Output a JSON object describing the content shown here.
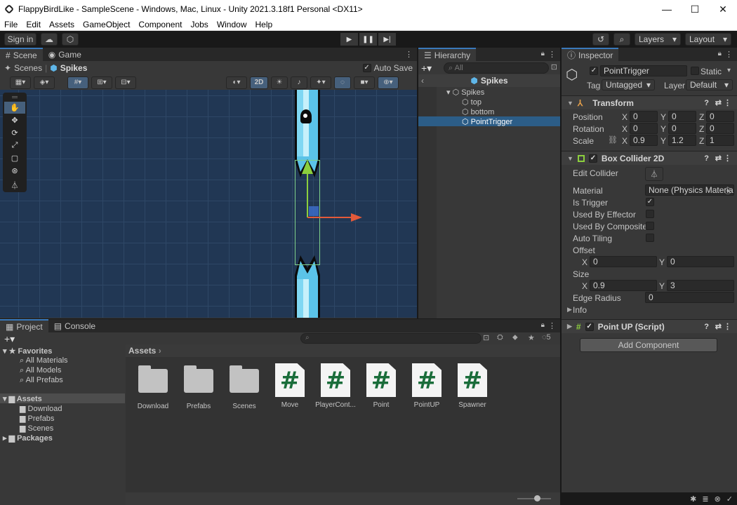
{
  "window": {
    "title": "FlappyBirdLike - SampleScene - Windows, Mac, Linux - Unity 2021.3.18f1 Personal <DX11>"
  },
  "menu": [
    "File",
    "Edit",
    "Assets",
    "GameObject",
    "Component",
    "Jobs",
    "Window",
    "Help"
  ],
  "toolbar": {
    "sign_in": "Sign in",
    "layers": "Layers",
    "layout": "Layout"
  },
  "scene": {
    "tabs": [
      "Scene",
      "Game"
    ],
    "breadcrumb_root": "Scenes",
    "breadcrumb_current": "Spikes",
    "auto_save": "Auto Save",
    "btn_2d": "2D"
  },
  "hierarchy": {
    "tab": "Hierarchy",
    "search_placeholder": "All",
    "header": "Spikes",
    "items": [
      {
        "label": "Spikes",
        "level": 0
      },
      {
        "label": "top",
        "level": 1
      },
      {
        "label": "bottom",
        "level": 1
      },
      {
        "label": "PointTrigger",
        "level": 1
      }
    ]
  },
  "inspector": {
    "tab": "Inspector",
    "object_name": "PointTrigger",
    "static_label": "Static",
    "tag_label": "Tag",
    "tag_value": "Untagged",
    "layer_label": "Layer",
    "layer_value": "Default",
    "transform": {
      "title": "Transform",
      "position_label": "Position",
      "position": {
        "x": "0",
        "y": "0",
        "z": "0"
      },
      "rotation_label": "Rotation",
      "rotation": {
        "x": "0",
        "y": "0",
        "z": "0"
      },
      "scale_label": "Scale",
      "scale": {
        "x": "0.9",
        "y": "1.2",
        "z": "1"
      }
    },
    "box_collider": {
      "title": "Box Collider 2D",
      "edit_collider": "Edit Collider",
      "material_label": "Material",
      "material_value": "None (Physics Materia",
      "is_trigger": "Is Trigger",
      "used_by_effector": "Used By Effector",
      "used_by_composite": "Used By Composite",
      "auto_tiling": "Auto Tiling",
      "offset_label": "Offset",
      "offset": {
        "x": "0",
        "y": "0"
      },
      "size_label": "Size",
      "size": {
        "x": "0.9",
        "y": "3"
      },
      "edge_radius_label": "Edge Radius",
      "edge_radius": "0",
      "info": "Info"
    },
    "script": {
      "title": "Point UP (Script)"
    },
    "add_component": "Add Component"
  },
  "project": {
    "tabs": [
      "Project",
      "Console"
    ],
    "badge": "5",
    "breadcrumb": "Assets",
    "favorites": {
      "title": "Favorites",
      "items": [
        "All Materials",
        "All Models",
        "All Prefabs"
      ]
    },
    "assets": {
      "title": "Assets",
      "items": [
        "Download",
        "Prefabs",
        "Scenes"
      ]
    },
    "packages": "Packages",
    "files": [
      {
        "name": "Download",
        "type": "folder"
      },
      {
        "name": "Prefabs",
        "type": "folder"
      },
      {
        "name": "Scenes",
        "type": "folder"
      },
      {
        "name": "Move",
        "type": "script"
      },
      {
        "name": "PlayerCont...",
        "type": "script"
      },
      {
        "name": "Point",
        "type": "script"
      },
      {
        "name": "PointUP",
        "type": "script"
      },
      {
        "name": "Spawner",
        "type": "script"
      }
    ]
  },
  "axis_labels": {
    "x": "X",
    "y": "Y",
    "z": "Z"
  }
}
